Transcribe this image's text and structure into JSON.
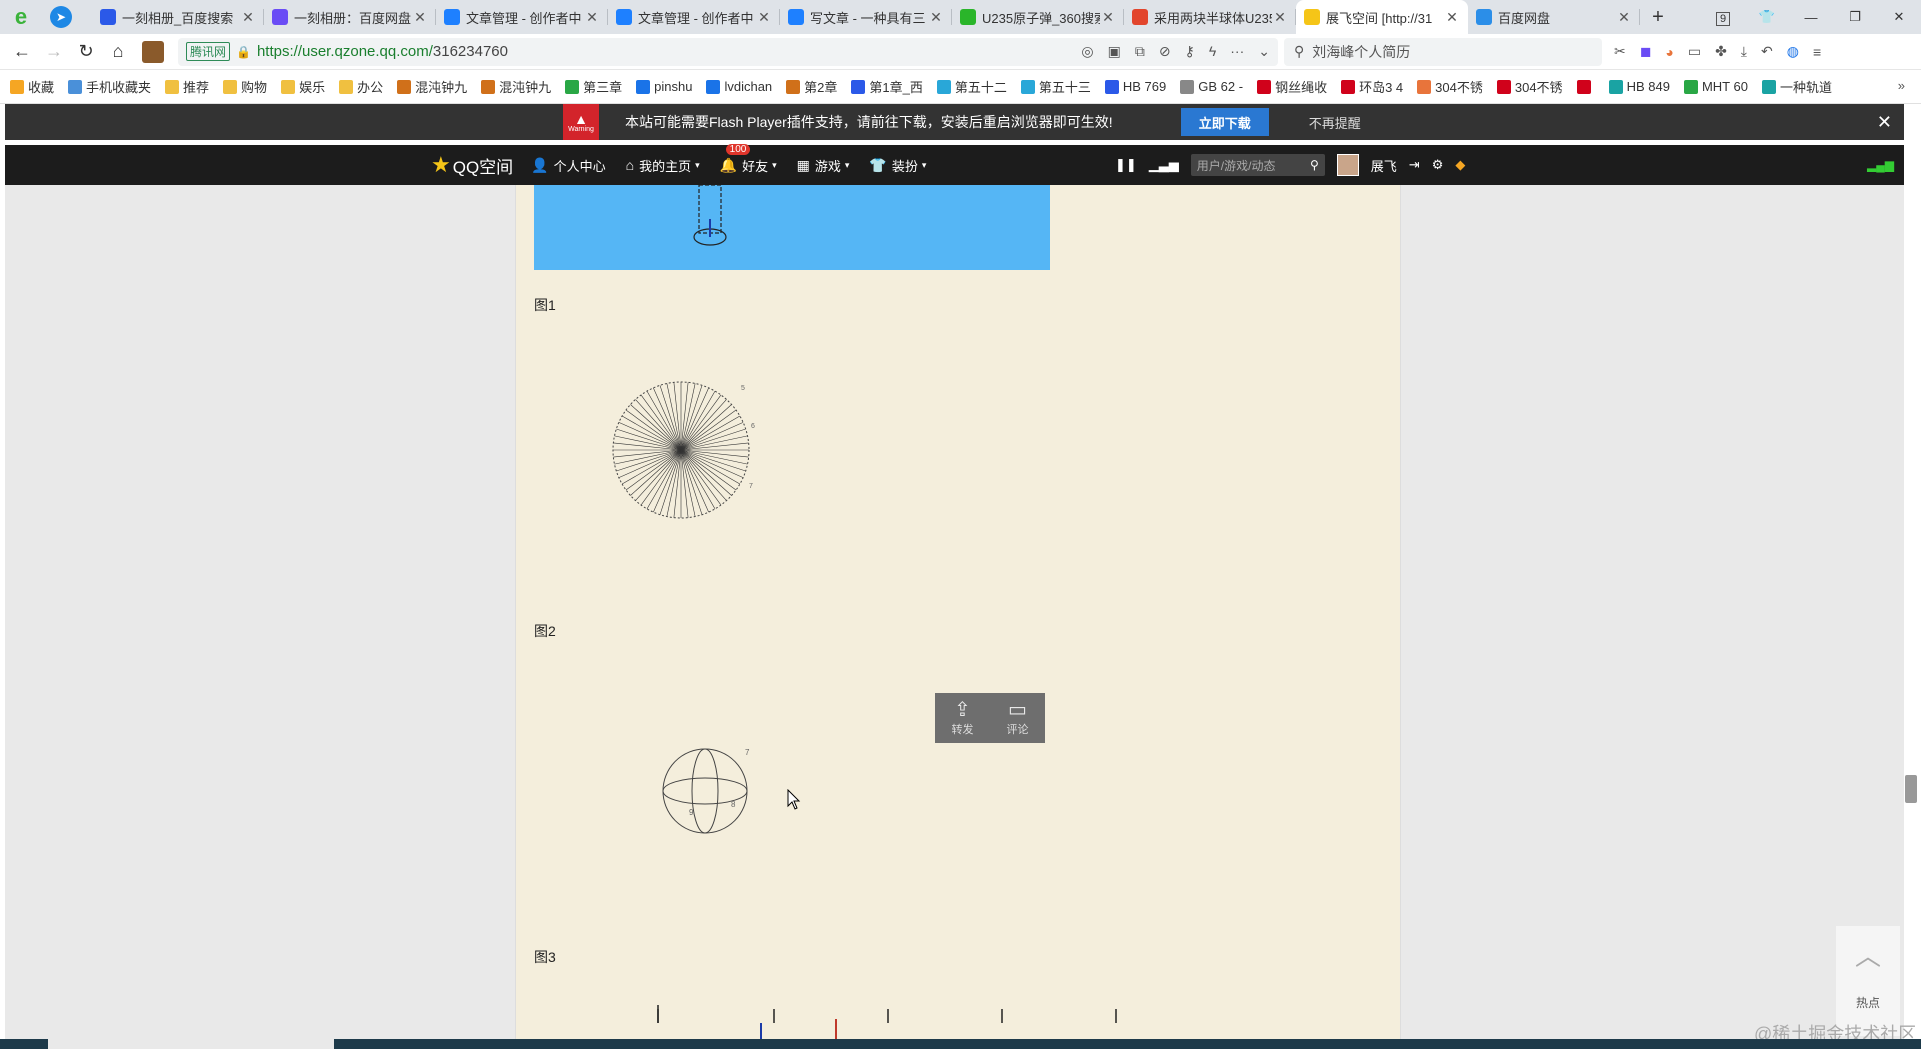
{
  "browser": {
    "tabs": [
      {
        "title": "一刻相册_百度搜索",
        "icon": "baidu-icon",
        "color": "#2b59e8"
      },
      {
        "title": "一刻相册：百度网盘",
        "icon": "kuaike-icon",
        "color": "#6a4cf5"
      },
      {
        "title": "文章管理 - 创作者中",
        "icon": "juejin-icon",
        "color": "#1e80ff"
      },
      {
        "title": "文章管理 - 创作者中",
        "icon": "juejin-icon",
        "color": "#1e80ff"
      },
      {
        "title": "写文章 - 一种具有三",
        "icon": "juejin-icon",
        "color": "#1e80ff"
      },
      {
        "title": "U235原子弹_360搜索",
        "icon": "360-icon",
        "color": "#2ab52a"
      },
      {
        "title": "采用两块半球体U235",
        "icon": "csdn-icon",
        "color": "#e2452c"
      },
      {
        "title": "展飞空间 [http://31",
        "icon": "qzone-star-icon",
        "color": "#f5c518",
        "active": true
      },
      {
        "title": "百度网盘",
        "icon": "baidupan-icon",
        "color": "#2b8ee8"
      }
    ],
    "tab_count_badge": "9",
    "url_badge": "腾讯网",
    "url_scheme_host": "https://user.qzone.qq.com/",
    "url_path": "316234760",
    "search_placeholder": "刘海峰个人简历"
  },
  "bookmarks": [
    {
      "label": "收藏",
      "color": "#f5a623"
    },
    {
      "label": "手机收藏夹",
      "color": "#4a90d9"
    },
    {
      "label": "推荐",
      "color": "#f0c040"
    },
    {
      "label": "购物",
      "color": "#f0c040"
    },
    {
      "label": "娱乐",
      "color": "#f0c040"
    },
    {
      "label": "办公",
      "color": "#f0c040"
    },
    {
      "label": "混沌钟九",
      "color": "#d0701a"
    },
    {
      "label": "混沌钟九",
      "color": "#d0701a"
    },
    {
      "label": "第三章",
      "color": "#29a745"
    },
    {
      "label": "pinshu",
      "color": "#1a73e8"
    },
    {
      "label": "lvdichan",
      "color": "#1a73e8"
    },
    {
      "label": "第2章 ",
      "color": "#d0701a"
    },
    {
      "label": "第1章_西",
      "color": "#2b59e8"
    },
    {
      "label": "第五十二",
      "color": "#29a7d8"
    },
    {
      "label": "第五十三",
      "color": "#29a7d8"
    },
    {
      "label": "HB 769",
      "color": "#2b59e8"
    },
    {
      "label": "GB 62 -",
      "color": "#888888"
    },
    {
      "label": "钢丝绳收",
      "color": "#d0021b"
    },
    {
      "label": "环岛3 4",
      "color": "#d0021b"
    },
    {
      "label": "304不锈",
      "color": "#e8743b"
    },
    {
      "label": "304不锈",
      "color": "#d0021b"
    },
    {
      "label": "",
      "color": "#d0021b"
    },
    {
      "label": "HB 849",
      "color": "#1aa3a3"
    },
    {
      "label": "MHT 60",
      "color": "#29a745"
    },
    {
      "label": "一种轨道",
      "color": "#1aa3a3"
    }
  ],
  "flash_bar": {
    "warning_label": "Warning",
    "message": "本站可能需要Flash Player插件支持，请前往下载，安装后重启浏览器即可生效!",
    "download_label": "立即下载",
    "ignore_label": "不再提醒"
  },
  "qzone_bar": {
    "logo_text": "QQ空间",
    "nav": [
      {
        "label": "个人中心"
      },
      {
        "label": "我的主页"
      },
      {
        "label": "好友",
        "badge": "100"
      },
      {
        "label": "游戏"
      },
      {
        "label": "装扮"
      }
    ],
    "search_placeholder": "用户/游戏/动态",
    "user_name": "展飞"
  },
  "article": {
    "captions": [
      "图1",
      "图2",
      "图3"
    ],
    "figure2_labels": [
      "7",
      "8",
      "9"
    ],
    "figure1_labels": [
      "5",
      "6",
      "7"
    ]
  },
  "float_share": {
    "forward_label": "转发",
    "comment_label": "评论"
  },
  "side_widget": {
    "hot_label": "热点"
  },
  "watermark": "@稀土掘金技术社区"
}
